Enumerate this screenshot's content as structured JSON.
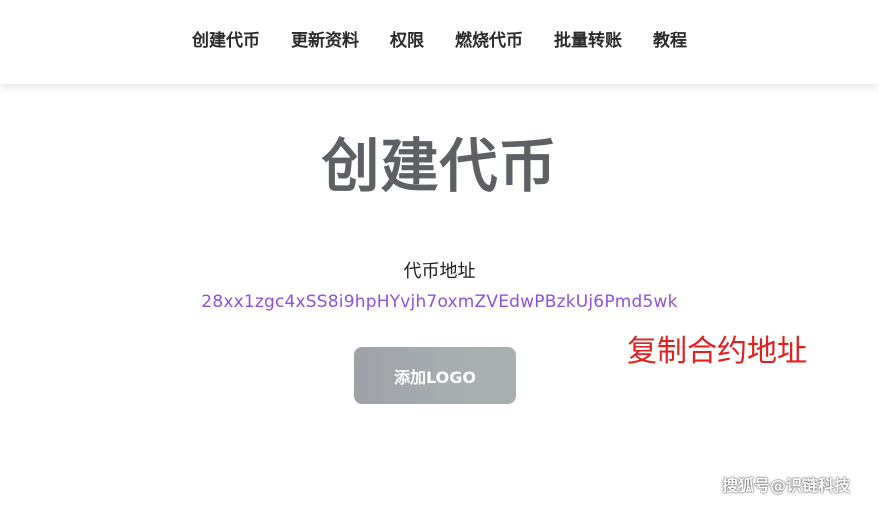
{
  "nav": {
    "items": [
      {
        "label": "创建代币"
      },
      {
        "label": "更新资料"
      },
      {
        "label": "权限"
      },
      {
        "label": "燃烧代币"
      },
      {
        "label": "批量转账"
      },
      {
        "label": "教程"
      }
    ]
  },
  "main": {
    "title": "创建代币",
    "address_label": "代币地址",
    "address_value": "28xx1zgc4xSS8i9hpHYvjh7oxmZVEdwPBzkUj6Pmd5wk",
    "add_logo_label": "添加LOGO"
  },
  "annotation": {
    "text": "复制合约地址"
  },
  "watermark": {
    "text": "搜狐号@识链科技"
  },
  "colors": {
    "address": "#8f52d6",
    "annotation": "#e32020",
    "title": "#5d6165"
  }
}
